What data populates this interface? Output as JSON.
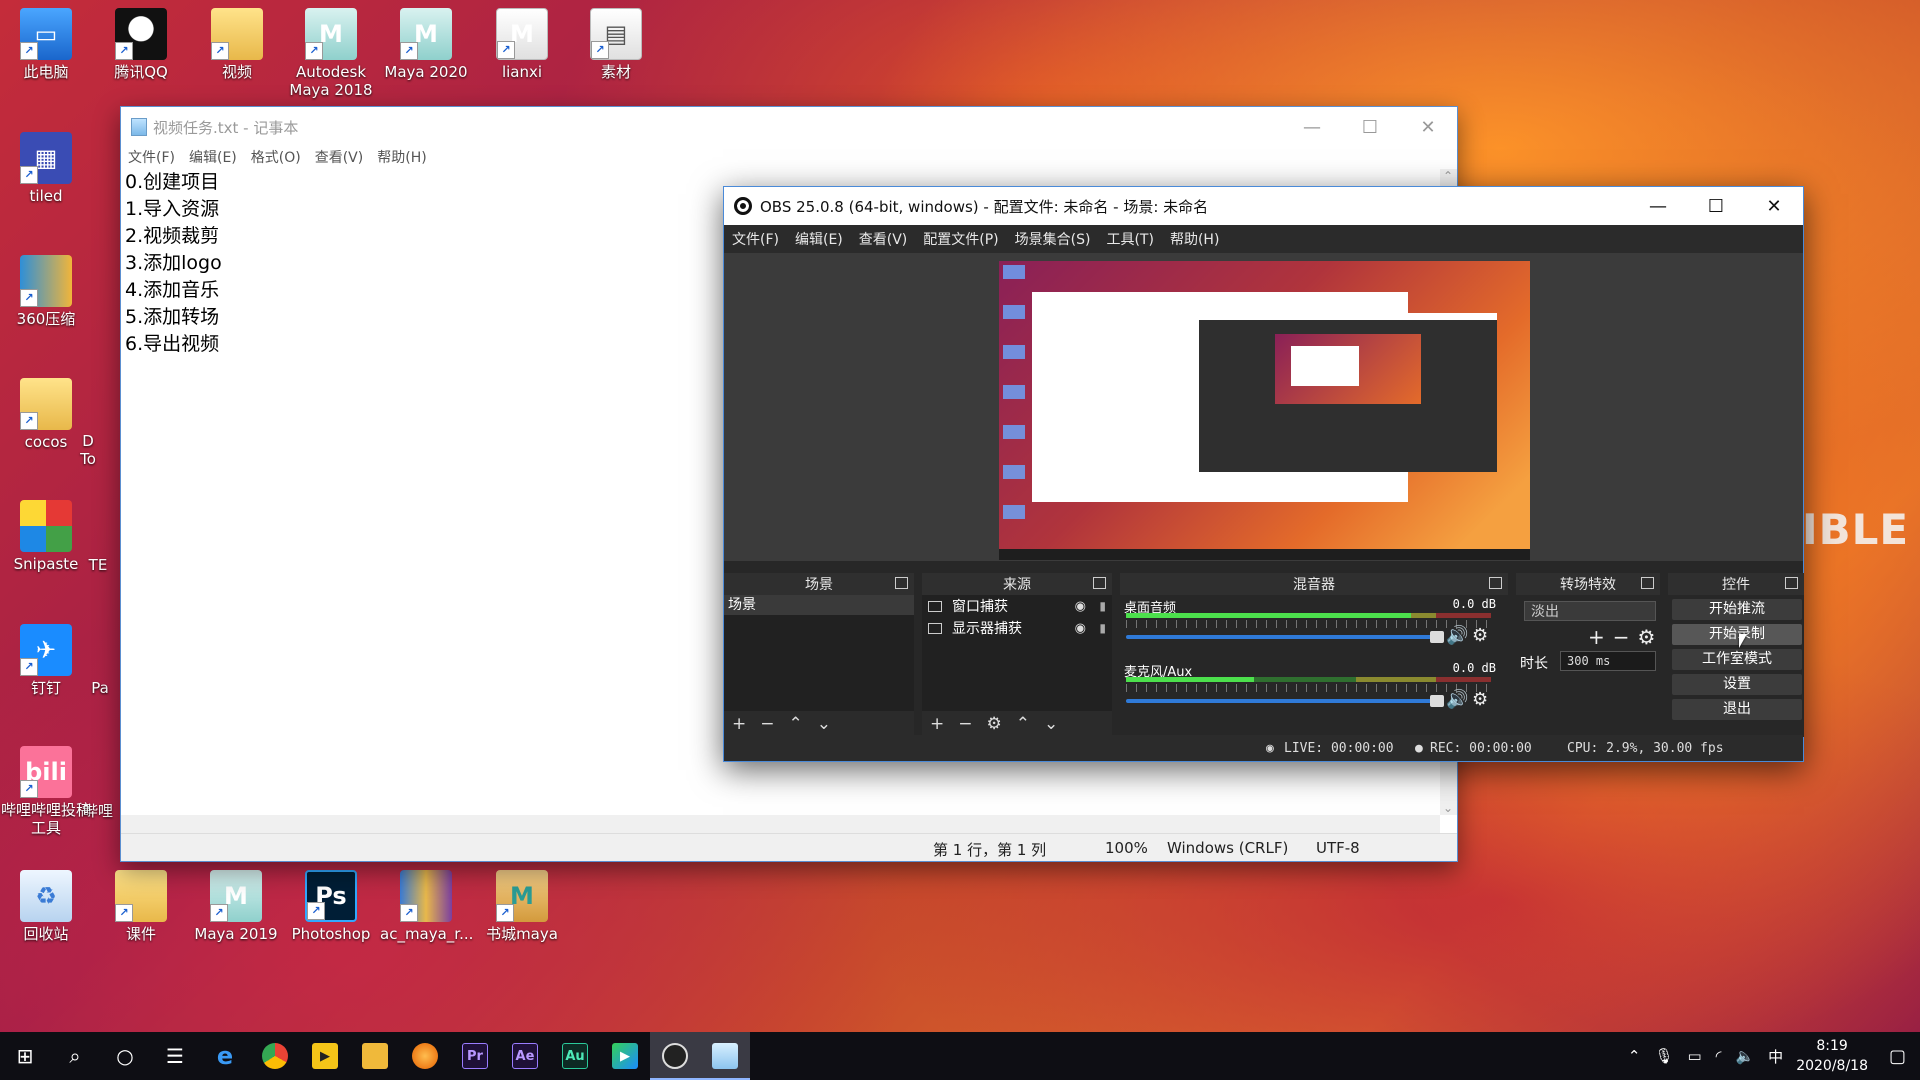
{
  "desktop": {
    "icons_left": [
      {
        "label": "此电脑",
        "icon": "computer-icon"
      },
      {
        "label": "tiled",
        "icon": "tiled-icon"
      },
      {
        "label": "360压缩",
        "icon": "zip-icon"
      },
      {
        "label": "cocos",
        "icon": "folder-icon"
      },
      {
        "label": "Snipaste",
        "icon": "snipaste-icon"
      },
      {
        "label": "钉钉",
        "icon": "dingtalk-icon"
      },
      {
        "label": "哔哩哔哩投稿工具",
        "icon": "bilibili-icon"
      },
      {
        "label": "回收站",
        "icon": "recycle-bin-icon"
      }
    ],
    "icons_top": [
      {
        "label": "腾讯QQ",
        "icon": "qq-icon"
      },
      {
        "label": "视频",
        "icon": "folder-icon"
      },
      {
        "label": "Autodesk Maya 2018",
        "icon": "maya-icon"
      },
      {
        "label": "Maya 2020",
        "icon": "maya-icon"
      },
      {
        "label": "lianxi",
        "icon": "file-icon"
      },
      {
        "label": "素材",
        "icon": "file-icon"
      }
    ],
    "icons_bottom": [
      {
        "label": "课件",
        "icon": "folder-icon"
      },
      {
        "label": "Maya 2019",
        "icon": "maya-icon"
      },
      {
        "label": "Photoshop",
        "icon": "photoshop-icon"
      },
      {
        "label": "ac_maya_r...",
        "icon": "winrar-icon"
      },
      {
        "label": "书城maya",
        "icon": "file-icon"
      }
    ],
    "partial_labels": [
      "D",
      "To",
      "TE",
      "Pa",
      "哔哩"
    ],
    "wallpaper_text": "IBLE"
  },
  "notepad": {
    "title": "视频任务.txt - 记事本",
    "menu": [
      "文件(F)",
      "编辑(E)",
      "格式(O)",
      "查看(V)",
      "帮助(H)"
    ],
    "lines": [
      "0.创建项目",
      "1.导入资源",
      "2.视频裁剪",
      "3.添加logo",
      "4.添加音乐",
      "5.添加转场",
      "6.导出视频"
    ],
    "status": {
      "position": "第 1 行，第 1 列",
      "zoom": "100%",
      "line_ending": "Windows (CRLF)",
      "encoding": "UTF-8"
    }
  },
  "obs": {
    "title": "OBS 25.0.8 (64-bit, windows) - 配置文件: 未命名 - 场景: 未命名",
    "menu": [
      "文件(F)",
      "编辑(E)",
      "查看(V)",
      "配置文件(P)",
      "场景集合(S)",
      "工具(T)",
      "帮助(H)"
    ],
    "docks": {
      "scenes": {
        "title": "场景",
        "items": [
          "场景"
        ]
      },
      "sources": {
        "title": "来源",
        "items": [
          "窗口捕获",
          "显示器捕获"
        ]
      },
      "mixer": {
        "title": "混音器",
        "channels": [
          {
            "name": "桌面音频",
            "db": "0.0 dB",
            "level": 0.78
          },
          {
            "name": "麦克风/Aux",
            "db": "0.0 dB",
            "level": 0.35
          }
        ]
      },
      "transitions": {
        "title": "转场特效",
        "selected": "淡出",
        "duration_label": "时长",
        "duration_value": "300 ms"
      },
      "controls": {
        "title": "控件",
        "buttons": [
          "开始推流",
          "开始录制",
          "工作室模式",
          "设置",
          "退出"
        ]
      }
    },
    "status": {
      "live": "LIVE: 00:00:00",
      "rec": "REC: 00:00:00",
      "cpu": "CPU: 2.9%, 30.00 fps"
    }
  },
  "taskbar": {
    "apps": [
      "start-icon",
      "search-icon",
      "cortana-icon",
      "task-view-icon",
      "edge-icon",
      "chrome-icon",
      "potplayer-icon",
      "file-explorer-icon",
      "firefox-icon",
      "premiere-icon",
      "after-effects-icon",
      "audition-icon",
      "media-player-icon",
      "obs-icon",
      "notepad-icon"
    ],
    "app_labels": {
      "pr": "Pr",
      "ae": "Ae",
      "au": "Au"
    },
    "ime": "中",
    "time": "8:19",
    "date": "2020/8/18"
  },
  "colors": {
    "obs_bg": "#272727",
    "obs_accent": "#2f7ad8",
    "taskbar": "#0e0e14"
  }
}
